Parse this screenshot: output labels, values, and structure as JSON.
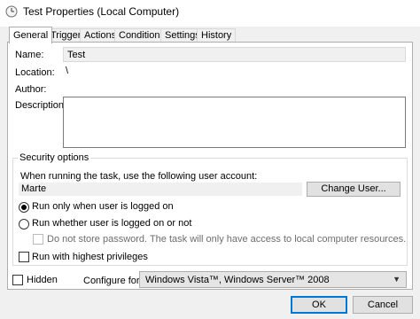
{
  "window": {
    "title": "Test Properties (Local Computer)"
  },
  "tabs": [
    "General",
    "Triggers",
    "Actions",
    "Conditions",
    "Settings",
    "History"
  ],
  "general": {
    "name_label": "Name:",
    "name_value": "Test",
    "location_label": "Location:",
    "location_value": "\\",
    "author_label": "Author:",
    "description_label": "Description:"
  },
  "security": {
    "group_label": "Security options",
    "account_prompt": "When running the task, use the following user account:",
    "account_value": "Marte",
    "change_user_button": "Change User...",
    "radio_logged_on": "Run only when user is logged on",
    "radio_whether": "Run whether user is logged on or not",
    "store_password": "Do not store password.  The task will only have access to local computer resources.",
    "highest_privileges": "Run with highest privileges",
    "selected_option": "Run only when user is logged on"
  },
  "bottom": {
    "hidden_label": "Hidden",
    "configure_label": "Configure for:",
    "configure_value": "Windows Vista™, Windows Server™ 2008",
    "ok_button": "OK",
    "cancel_button": "Cancel"
  }
}
